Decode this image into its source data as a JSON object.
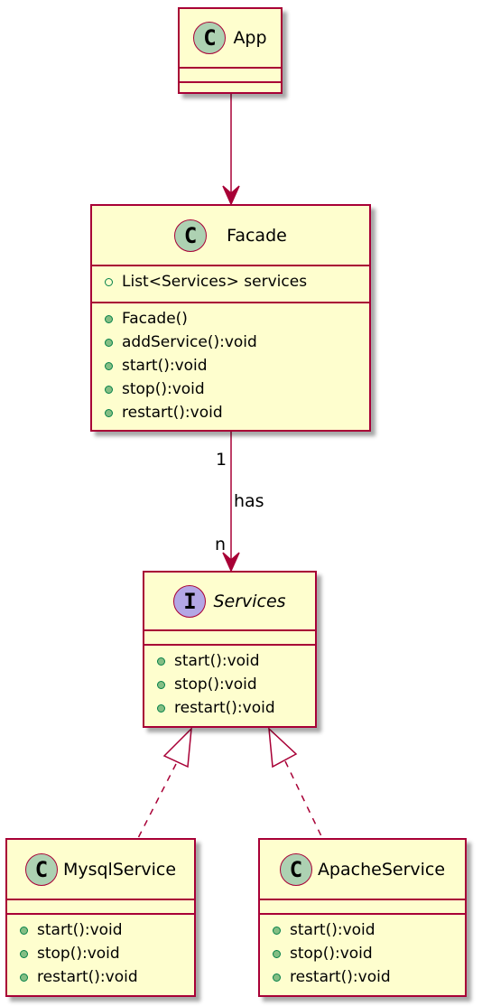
{
  "colors": {
    "border": "#a80036",
    "fill": "#fefece",
    "class_badge": "#add1b2",
    "interface_badge": "#b4a7e5",
    "public_method": "#84be84"
  },
  "classes": {
    "app": {
      "name": "App",
      "badge": "C",
      "attributes": [],
      "methods": []
    },
    "facade": {
      "name": "Facade",
      "badge": "C",
      "attributes": [
        "List<Services> services"
      ],
      "methods": [
        "Facade()",
        "addService():void",
        "start():void",
        "stop():void",
        "restart():void"
      ]
    },
    "services": {
      "name": "Services",
      "badge": "I",
      "stereotype": "interface",
      "attributes": [],
      "methods": [
        "start():void",
        "stop():void",
        "restart():void"
      ]
    },
    "mysql": {
      "name": "MysqlService",
      "badge": "C",
      "attributes": [],
      "methods": [
        "start():void",
        "stop():void",
        "restart():void"
      ]
    },
    "apache": {
      "name": "ApacheService",
      "badge": "C",
      "attributes": [],
      "methods": [
        "start():void",
        "stop():void",
        "restart():void"
      ]
    }
  },
  "relations": {
    "app_facade": {
      "from": "App",
      "to": "Facade",
      "type": "association"
    },
    "facade_services": {
      "from": "Facade",
      "to": "Services",
      "type": "association",
      "label": "has",
      "from_mult": "1",
      "to_mult": "n"
    },
    "mysql_services": {
      "from": "MysqlService",
      "to": "Services",
      "type": "realization"
    },
    "apache_services": {
      "from": "ApacheService",
      "to": "Services",
      "type": "realization"
    }
  }
}
